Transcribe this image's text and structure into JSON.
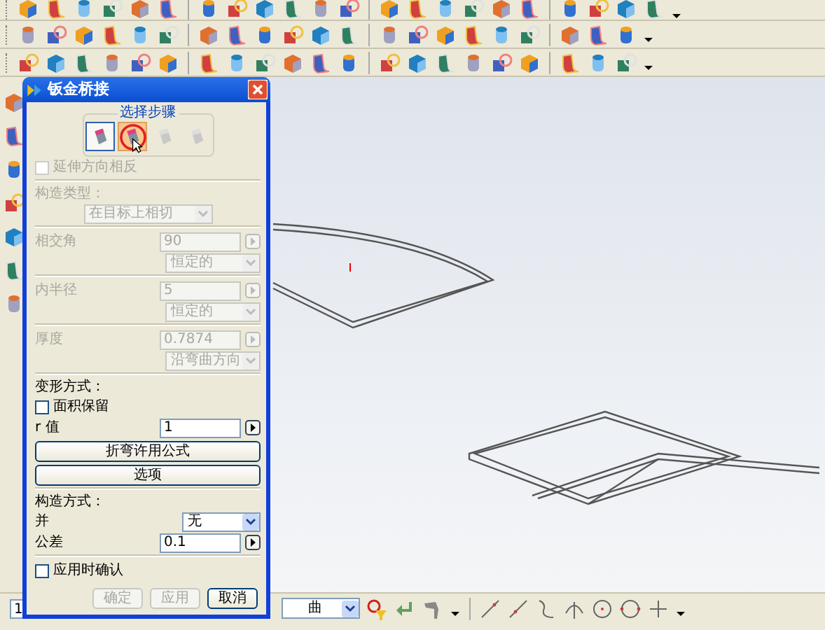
{
  "dialog": {
    "title": "钣金桥接",
    "step_group": "选择步骤",
    "steps": [
      {
        "selected": false,
        "disabled": false
      },
      {
        "selected": true,
        "disabled": false
      },
      {
        "selected": false,
        "disabled": true
      },
      {
        "selected": false,
        "disabled": true
      }
    ],
    "reverse_extension": {
      "label": "延伸方向相反",
      "checked": false,
      "disabled": true
    },
    "construction_type": {
      "label": "构造类型：",
      "value": "在目标上相切",
      "disabled": true
    },
    "params": [
      {
        "label": "相交角",
        "value": "90",
        "mode": "恒定的",
        "disabled": true
      },
      {
        "label": "内半径",
        "value": "5",
        "mode": "恒定的",
        "disabled": true
      },
      {
        "label": "厚度",
        "value": "0.7874",
        "mode": "沿弯曲方向",
        "disabled": true
      }
    ],
    "deform": {
      "heading": "变形方式：",
      "preserve_area": {
        "label": "面积保留",
        "checked": false
      },
      "r": {
        "label": "r 值",
        "value": "1"
      },
      "buttons": [
        "折弯许用公式",
        "选项"
      ]
    },
    "construction": {
      "heading": "构造方式：",
      "rows": [
        {
          "kind": "dropdown",
          "label": "并",
          "value": "无"
        },
        {
          "kind": "field",
          "label": "公差",
          "value": "0.1"
        }
      ]
    },
    "confirm_on_apply": {
      "label": "应用时确认",
      "checked": false
    },
    "actions": [
      {
        "label": "确定",
        "disabled": true
      },
      {
        "label": "应用",
        "disabled": true
      },
      {
        "label": "取消",
        "disabled": false
      }
    ]
  },
  "bottom_bar": {
    "field": "1",
    "dropdown": "曲"
  }
}
